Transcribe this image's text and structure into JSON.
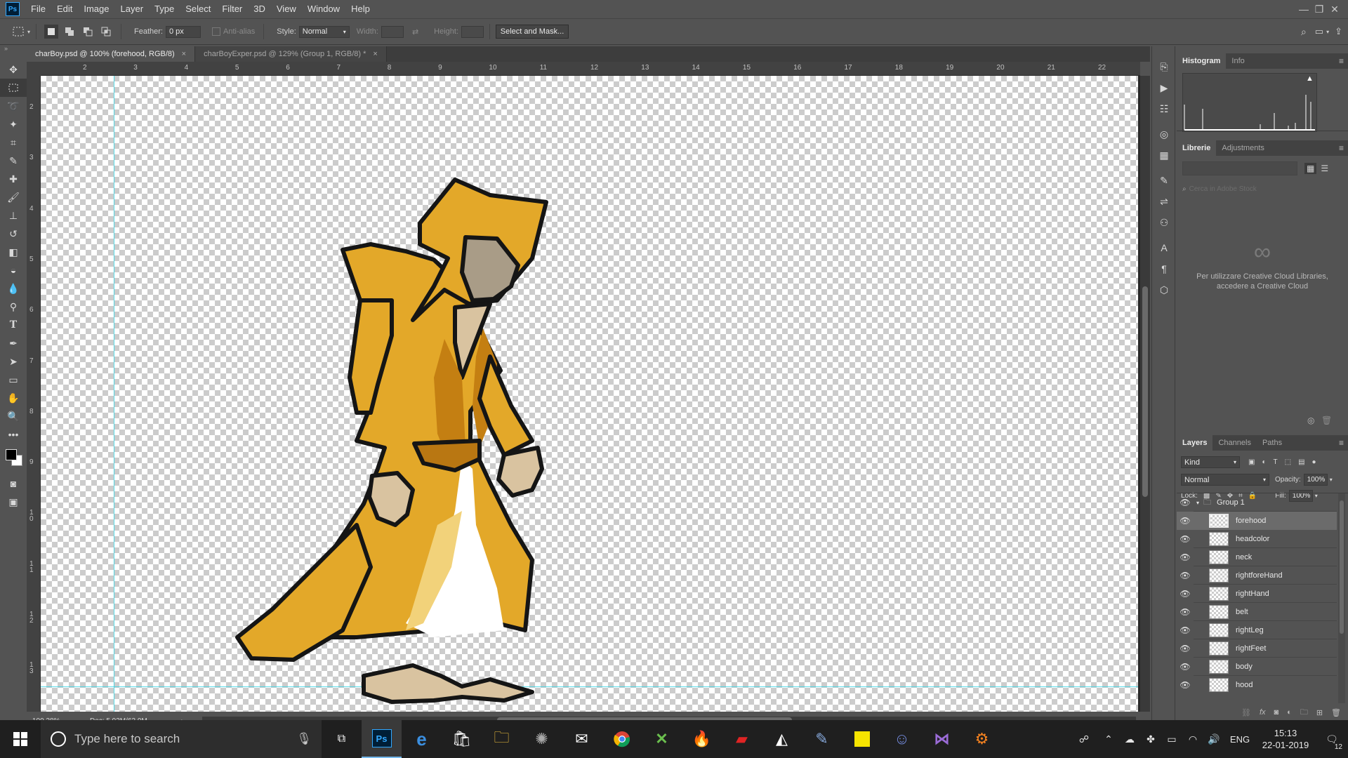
{
  "menu": {
    "logo": "Ps",
    "items": [
      "File",
      "Edit",
      "Image",
      "Layer",
      "Type",
      "Select",
      "Filter",
      "3D",
      "View",
      "Window",
      "Help"
    ]
  },
  "options": {
    "feather_label": "Feather:",
    "feather_value": "0 px",
    "antialias_label": "Anti-alias",
    "style_label": "Style:",
    "style_value": "Normal",
    "width_label": "Width:",
    "height_label": "Height:",
    "select_mask_button": "Select and Mask..."
  },
  "tabs": [
    {
      "title": "charBoy.psd @ 100% (forehood, RGB/8)",
      "close": "×"
    },
    {
      "title": "charBoyExper.psd @ 129% (Group 1, RGB/8) *",
      "close": "×"
    }
  ],
  "ruler": {
    "top": [
      "2",
      "3",
      "4",
      "5",
      "6",
      "7",
      "8",
      "9",
      "10",
      "11",
      "12",
      "13",
      "14",
      "15",
      "16",
      "17",
      "18",
      "19",
      "20",
      "21",
      "22"
    ],
    "left": [
      "2",
      "3",
      "4",
      "5",
      "6",
      "7",
      "8",
      "9",
      "1 0",
      "1 1",
      "1 2",
      "1 3"
    ]
  },
  "status": {
    "zoom": "100.38%",
    "doc": "Doc: 5.93M/63.9M"
  },
  "panels": {
    "histogram_tabs": [
      "Histogram",
      "Info"
    ],
    "library_tabs": [
      "Librerie",
      "Adjustments"
    ],
    "library_search_placeholder": "Cerca in Adobe Stock",
    "library_message": "Per utilizzare Creative Cloud Libraries, accedere a Creative Cloud",
    "layers_tabs": [
      "Layers",
      "Channels",
      "Paths"
    ],
    "filter_kind": "Kind",
    "blend_mode": "Normal",
    "opacity_label": "Opacity:",
    "opacity_value": "100%",
    "lock_label": "Lock:",
    "fill_label": "Fill:",
    "fill_value": "100%"
  },
  "layers": {
    "group": "Group 1",
    "items": [
      "forehood",
      "headcolor",
      "neck",
      "rightforeHand",
      "rightHand",
      "belt",
      "rightLeg",
      "rightFeet",
      "body",
      "hood"
    ]
  },
  "taskbar": {
    "search_placeholder": "Type here to search",
    "lang": "ENG",
    "time": "15:13",
    "date": "22-01-2019",
    "notif_count": "12"
  },
  "colors": {
    "robe": "#e3a829",
    "robe_shade": "#c47f12",
    "skin": "#d9c3a0",
    "guide": "#33d6e6"
  }
}
